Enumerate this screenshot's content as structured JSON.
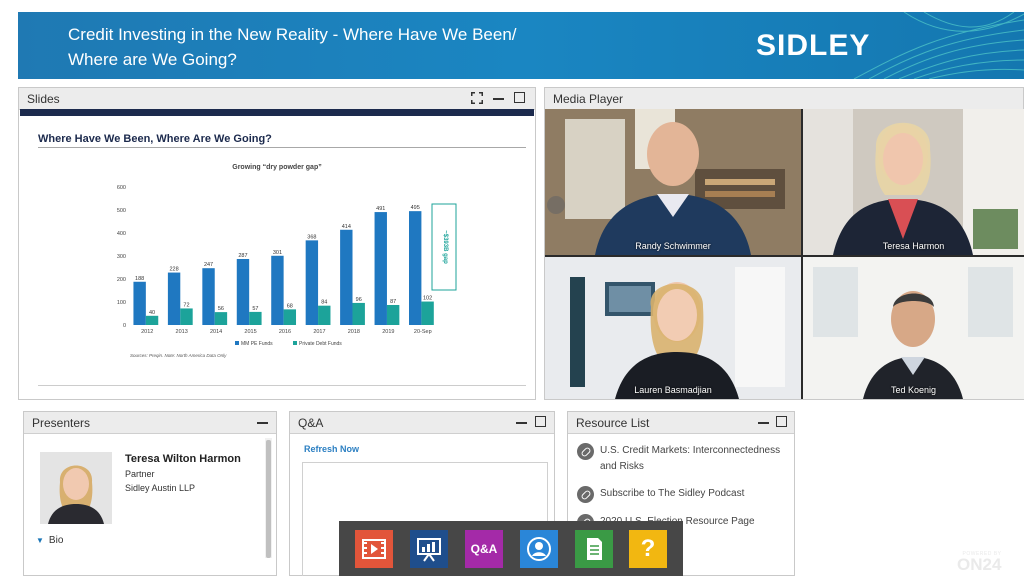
{
  "banner": {
    "title_line1": "Credit Investing in the New Reality - Where Have We Been/",
    "title_line2": "Where are We Going?",
    "logo": "SIDLEY"
  },
  "slides_panel": {
    "title": "Slides",
    "slide_title": "Where Have We Been, Where Are We Going?"
  },
  "chart_data": {
    "type": "bar",
    "title": "Growing “dry powder gap”",
    "categories": [
      "2012",
      "2013",
      "2014",
      "2015",
      "2016",
      "2017",
      "2018",
      "2019",
      "20-Sep"
    ],
    "series": [
      {
        "name": "MM PE Funds",
        "values": [
          188,
          228,
          247,
          287,
          301,
          368,
          414,
          491,
          495
        ],
        "color": "#1f78c1"
      },
      {
        "name": "Private Debt Funds",
        "values": [
          40,
          72,
          56,
          57,
          68,
          84,
          96,
          87,
          102
        ],
        "color": "#1ca39a"
      }
    ],
    "ylim": [
      0,
      600
    ],
    "yticks": [
      "0",
      "100",
      "200",
      "300",
      "400",
      "500",
      "600"
    ],
    "annotation": "~$393B gap",
    "source": "Sources: Preqin. Note: North America Data Only"
  },
  "media_panel": {
    "title": "Media Player",
    "participants": [
      "Randy Schwimmer",
      "Teresa Harmon",
      "Lauren Basmadjian",
      "Ted Koenig"
    ]
  },
  "presenters_panel": {
    "title": "Presenters",
    "name": "Teresa Wilton Harmon",
    "role": "Partner",
    "firm": "Sidley Austin LLP",
    "bio_label": "Bio"
  },
  "qa_panel": {
    "title": "Q&A",
    "refresh": "Refresh Now"
  },
  "resource_panel": {
    "title": "Resource List",
    "items": [
      "U.S. Credit Markets: Interconnectedness and Risks",
      "Subscribe to The Sidley Podcast",
      "2020 U.S. Election Resource Page"
    ]
  },
  "dock": {
    "qa_label": "Q&A",
    "help_label": "?"
  },
  "powered": {
    "line1": "POWERED BY",
    "line2": "ON24"
  }
}
